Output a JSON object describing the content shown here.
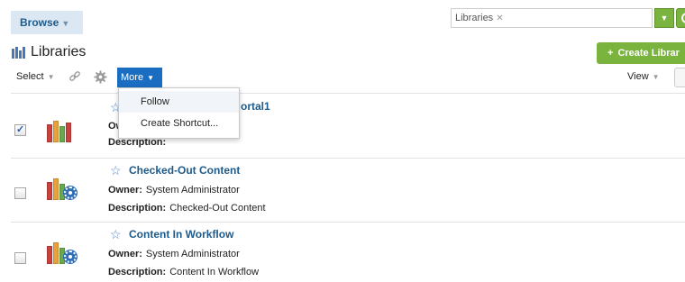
{
  "header": {
    "browse_label": "Browse",
    "search_chip": "Libraries",
    "search_value": ""
  },
  "page": {
    "title": "Libraries",
    "create_label": "Create Librar"
  },
  "toolbar": {
    "select_label": "Select",
    "more_label": "More",
    "view_label": "View"
  },
  "menu": {
    "items": [
      {
        "label": "Follow"
      },
      {
        "label": "Create Shortcut..."
      }
    ]
  },
  "rows": [
    {
      "title": "ortal1",
      "owner_label": "Ow",
      "owner_value": "",
      "description_label": "Description:",
      "description_value": "",
      "checked": true,
      "icon": "library-icon"
    },
    {
      "title": "Checked-Out Content",
      "owner_label": "Owner:",
      "owner_value": "System Administrator",
      "description_label": "Description:",
      "description_value": "Checked-Out Content",
      "checked": false,
      "icon": "library-query-icon"
    },
    {
      "title": "Content In Workflow",
      "owner_label": "Owner:",
      "owner_value": "System Administrator",
      "description_label": "Description:",
      "description_value": "Content In Workflow",
      "checked": false,
      "icon": "library-query-icon"
    }
  ],
  "colors": {
    "accent_blue": "#1a6dc0",
    "accent_green": "#7ab33d",
    "title_blue": "#1e5a8a"
  }
}
